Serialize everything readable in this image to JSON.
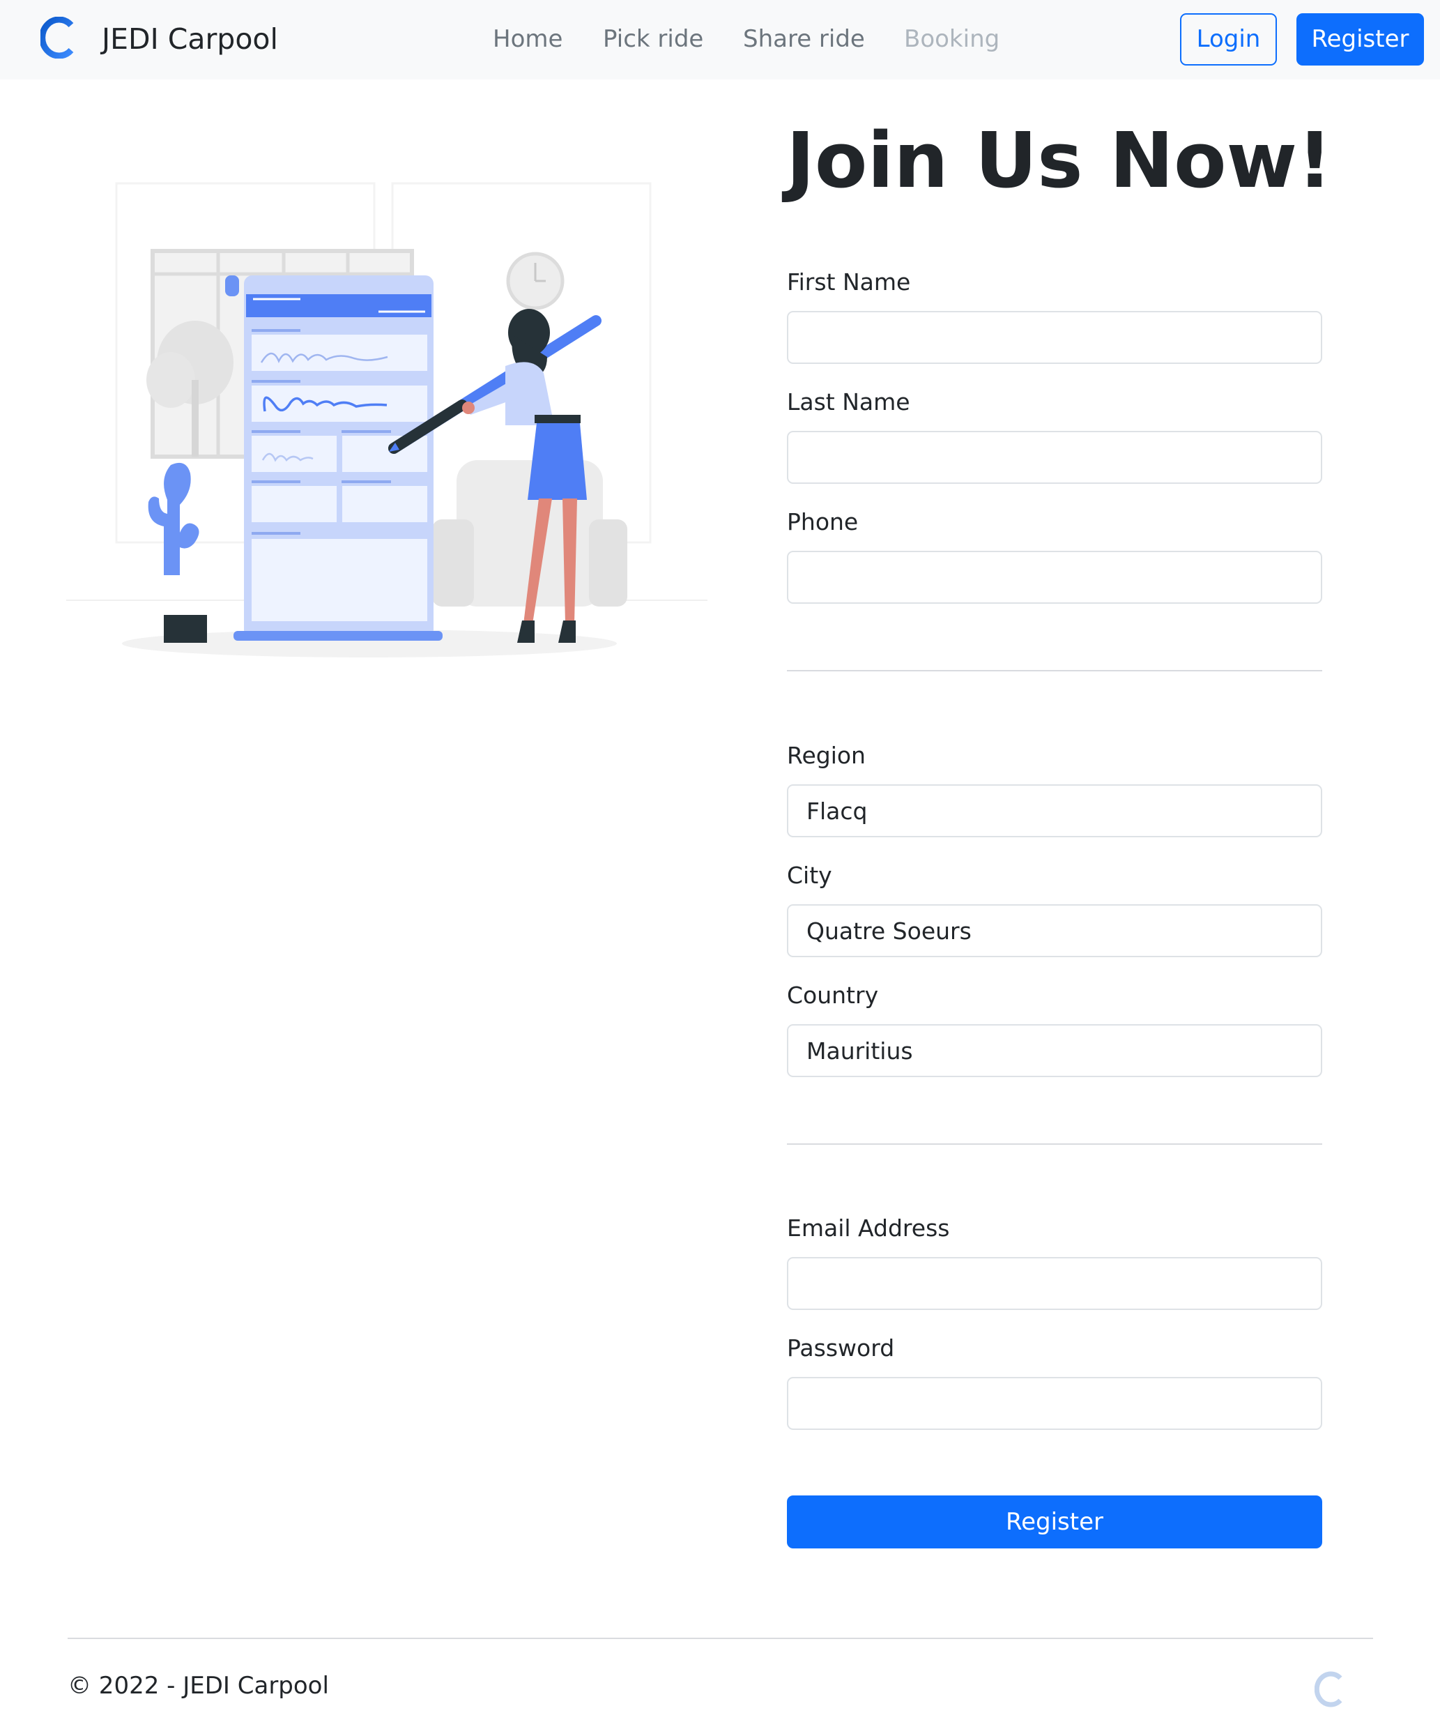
{
  "navbar": {
    "brand": "JEDI Carpool",
    "brand_icon": "c-logo-icon",
    "links": [
      {
        "label": "Home"
      },
      {
        "label": "Pick ride"
      },
      {
        "label": "Share ride"
      },
      {
        "label": "Booking",
        "disabled": true
      }
    ],
    "login_label": "Login",
    "register_label": "Register"
  },
  "illustration": "woman-signing-form-illustration",
  "form": {
    "heading": "Join Us Now!",
    "first_name": {
      "label": "First Name",
      "value": ""
    },
    "last_name": {
      "label": "Last Name",
      "value": ""
    },
    "phone": {
      "label": "Phone",
      "value": ""
    },
    "region": {
      "label": "Region",
      "value": "Flacq"
    },
    "city": {
      "label": "City",
      "value": "Quatre Soeurs"
    },
    "country": {
      "label": "Country",
      "value": "Mauritius"
    },
    "email": {
      "label": "Email Address",
      "value": ""
    },
    "password": {
      "label": "Password",
      "value": ""
    },
    "submit_label": "Register"
  },
  "footer": {
    "text": "© 2022 - JEDI Carpool",
    "logo_icon": "c-logo-icon"
  },
  "colors": {
    "primary": "#0d6efd",
    "navbar_bg": "#f8f9fa",
    "illustration_blue": "#4f7ef5",
    "illustration_light": "#c7d5fb"
  }
}
